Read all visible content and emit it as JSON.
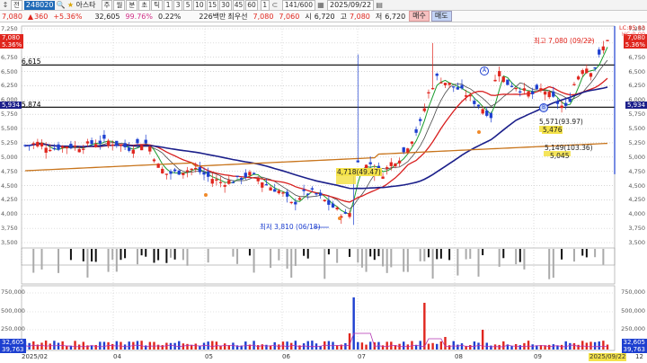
{
  "toolbar1": {
    "arrow_glyph": "↕",
    "type_label": "전",
    "code": "248020",
    "stock_name": "아스타",
    "period_buttons": [
      "주",
      "월",
      "분",
      "초",
      "틱"
    ],
    "interval_buttons": [
      "1",
      "3",
      "5",
      "10",
      "15",
      "30",
      "45",
      "60"
    ],
    "unit_value": "1",
    "count_display": "141/600",
    "date_value": "2025/09/22"
  },
  "quote": {
    "price": "7,080",
    "change": "360",
    "change_pct": "+5.36%",
    "volume": "32,605",
    "volume_ratio": "99.76%",
    "turnover_pct": "0.22%",
    "amount": "226백만",
    "ask_label": "최우선",
    "ask_price": "7,080",
    "bid_price": "7,060",
    "open_label": "시",
    "open": "6,720",
    "high_label": "고",
    "high": "7,080",
    "low_label": "저",
    "low": "6,720",
    "buy_label": "매수",
    "sell_label": "매도"
  },
  "price_axis": {
    "left_ticks": [
      "7,250",
      "7,000",
      "6,750",
      "6,500",
      "6,250",
      "6,000",
      "5,750",
      "5,500",
      "5,250",
      "5,000",
      "4,750",
      "4,500",
      "4,250",
      "4,000",
      "3,750",
      "3,500"
    ],
    "right_ticks": [
      "7,250",
      "7,000",
      "6,750",
      "6,500",
      "6,250",
      "6,000",
      "5,750",
      "5,500",
      "5,250",
      "5,000",
      "4,750",
      "4,500",
      "4,250",
      "4,000",
      "3,750",
      "3,500"
    ],
    "left_badge_price": "7,080",
    "left_badge_pct": "5.36%",
    "right_badge_price": "7,080",
    "right_badge_pct": "5.36%",
    "right_note": "LC:85.83",
    "right_note2": "HC:0.00"
  },
  "support_lines": {
    "upper": "6,615",
    "lower": "5,874",
    "lower_badge": "5,934"
  },
  "annotations": {
    "high": "최고 7,080 (09/22)",
    "low": "최저 3,810 (06/18)",
    "box1": "4,718(49.47)",
    "box2": "5,571(93.97)",
    "box2_sub": "5,476",
    "box3": "5,149(103.36)",
    "box3_sub": "5,045",
    "circle_a": "A",
    "circle_b": "B"
  },
  "volume_axis": {
    "left_ticks": [
      "750,000",
      "500,000",
      "250,000"
    ],
    "right_ticks": [
      "750,000",
      "500,000",
      "250,000"
    ],
    "left_badge": "32,605",
    "left_badge2": "39,763",
    "right_badge": "32,605",
    "right_badge2": "39,763"
  },
  "x_axis": {
    "labels": [
      "2025/02",
      "04",
      "05",
      "06",
      "07",
      "08",
      "09"
    ],
    "cursor_date": "2025/09/22",
    "cursor_suffix": "12"
  },
  "colors": {
    "up": "#e0261e",
    "down": "#1d3fd0",
    "ma_green": "#1a9c2e",
    "ma_red": "#d81e1e",
    "ma_navy": "#1b1f8a",
    "ma_orange": "#c8741b",
    "accent": "#1f6ab7"
  }
}
